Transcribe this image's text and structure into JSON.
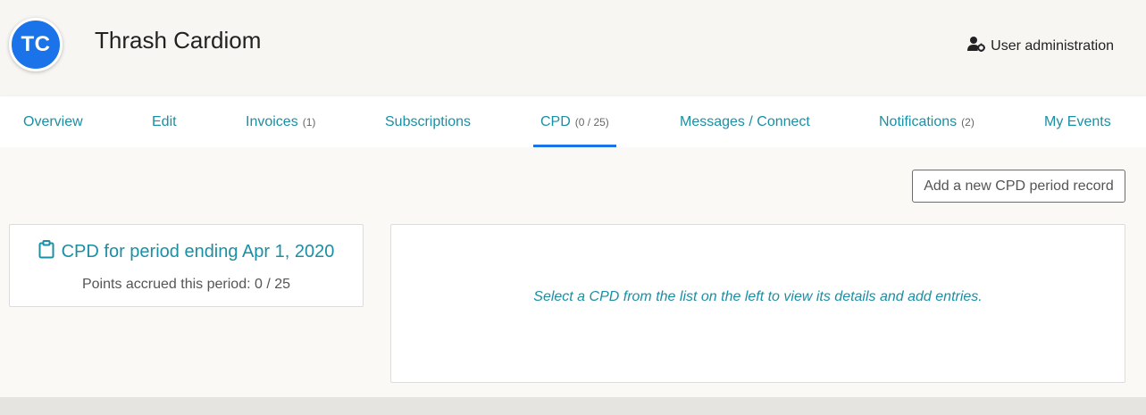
{
  "header": {
    "avatar_initials": "TC",
    "user_name": "Thrash Cardiom",
    "admin_link": {
      "label": "User administration",
      "icon": "user-gear-icon"
    }
  },
  "tabs": [
    {
      "label": "Overview",
      "count": ""
    },
    {
      "label": "Edit",
      "count": ""
    },
    {
      "label": "Invoices",
      "count": "(1)"
    },
    {
      "label": "Subscriptions",
      "count": ""
    },
    {
      "label": "CPD",
      "count": "(0 / 25)",
      "active": true
    },
    {
      "label": "Messages / Connect",
      "count": ""
    },
    {
      "label": "Notifications",
      "count": "(2)"
    },
    {
      "label": "My Events",
      "count": ""
    }
  ],
  "main": {
    "add_button_label": "Add a new CPD period record",
    "cpd_card": {
      "icon": "clipboard-icon",
      "title": "CPD for period ending Apr 1, 2020",
      "points_text": "Points accrued this period: 0 / 25"
    },
    "detail_message": "Select a CPD from the list on the left to view its details and add entries."
  },
  "colors": {
    "accent": "#1a73e8",
    "link": "#1b8fa3"
  }
}
